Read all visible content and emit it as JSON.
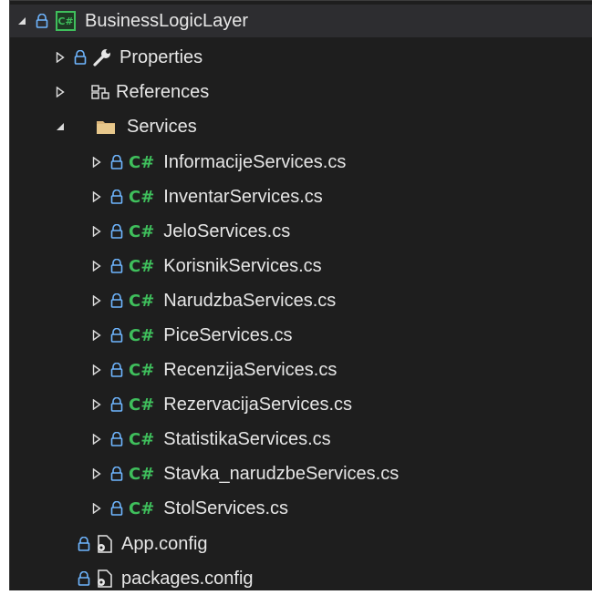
{
  "project": {
    "name": "BusinessLogicLayer",
    "icon_text": "C#"
  },
  "items": {
    "properties": "Properties",
    "references": "References",
    "services": "Services",
    "app_config": "App.config",
    "packages_config": "packages.config"
  },
  "service_files": [
    "InformacijeServices.cs",
    "InventarServices.cs",
    "JeloServices.cs",
    "KorisnikServices.cs",
    "NarudzbaServices.cs",
    "PiceServices.cs",
    "RecenzijaServices.cs",
    "RezervacijaServices.cs",
    "StatistikaServices.cs",
    "Stavka_narudzbeServices.cs",
    "StolServices.cs"
  ],
  "file_icon_text": "C#",
  "colors": {
    "background": "#1e1e1e",
    "text": "#e6e6e6",
    "csharp_green": "#3fbf5c",
    "lock_blue": "#6fb6ff",
    "folder": "#dcb67a"
  }
}
